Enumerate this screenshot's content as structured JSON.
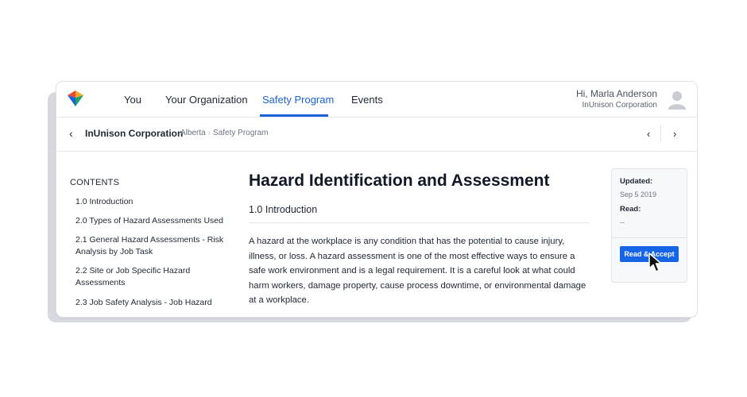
{
  "nav": {
    "items": [
      {
        "label": "You"
      },
      {
        "label": "Your Organization"
      },
      {
        "label": "Safety Program"
      },
      {
        "label": "Events"
      }
    ],
    "greeting": "Hi, Marla Anderson",
    "organization": "InUnison Corporation"
  },
  "breadcrumb": {
    "back_icon": "chevron-left-icon",
    "root": "InUnison Corporation",
    "parts": [
      "Alberta",
      "Safety Program"
    ],
    "prev_icon": "chevron-left-icon",
    "next_icon": "chevron-right-icon"
  },
  "contents": {
    "title": "CONTENTS",
    "items": [
      "1.0 Introduction",
      "2.0 Types of Hazard Assessments Used",
      "2.1 General Hazard Assessments - Risk Analysis by Job Task",
      "2.2 Site or Job Specific Hazard Assessments",
      "2.3 Job Safety Analysis - Job Hazard"
    ]
  },
  "main": {
    "title": "Hazard Identification and Assessment",
    "section": "1.0 Introduction",
    "body": "A hazard at the workplace is any condition that has the potential to cause injury, illness, or loss. A hazard assessment is one of the most effective ways to ensure a safe work environment and is a legal requirement. It is a careful look at what could harm workers, damage property, cause process downtime, or environmental damage at a workplace."
  },
  "info": {
    "updated_label": "Updated:",
    "updated_value": "Sep 5 2019",
    "read_label": "Read:",
    "read_value": "--",
    "button_label": "Read & Accept"
  },
  "colors": {
    "accent": "#1a62d8",
    "button": "#1565e6",
    "logo": [
      "#e8473c",
      "#f5a623",
      "#1ea36b",
      "#1a62d8"
    ]
  }
}
